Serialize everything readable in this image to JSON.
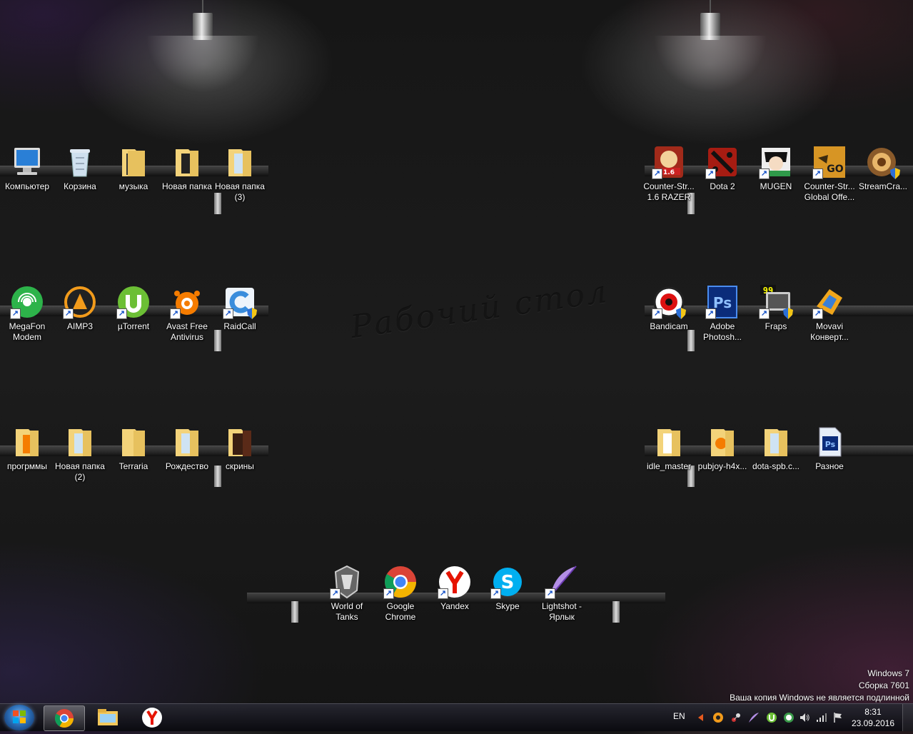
{
  "desktop": {
    "watermark": "Рабочий стол",
    "icons": [
      {
        "id": "computer",
        "label": "Компьютер"
      },
      {
        "id": "recycle",
        "label": "Корзина"
      },
      {
        "id": "music",
        "label": "музыка"
      },
      {
        "id": "newfolder",
        "label": "Новая папка"
      },
      {
        "id": "newfolder3",
        "label": "Новая папка\n(3)"
      },
      {
        "id": "megafon",
        "label": "MegaFon\nModem"
      },
      {
        "id": "aimp",
        "label": "AIMP3"
      },
      {
        "id": "utorrent",
        "label": "µTorrent"
      },
      {
        "id": "avast",
        "label": "Avast Free\nAntivirus"
      },
      {
        "id": "raidcall",
        "label": "RaidCall"
      },
      {
        "id": "programs",
        "label": "прогрммы"
      },
      {
        "id": "newfolder2",
        "label": "Новая папка\n(2)"
      },
      {
        "id": "terraria",
        "label": "Terraria"
      },
      {
        "id": "christmas",
        "label": "Рождество"
      },
      {
        "id": "screens",
        "label": "скрины"
      },
      {
        "id": "cs16",
        "label": "Counter-Str...\n1.6 RAZER"
      },
      {
        "id": "dota2",
        "label": "Dota 2"
      },
      {
        "id": "mugen",
        "label": "MUGEN"
      },
      {
        "id": "csgo",
        "label": "Counter-Str...\nGlobal Offe..."
      },
      {
        "id": "streamcraft",
        "label": "StreamCra..."
      },
      {
        "id": "bandicam",
        "label": "Bandicam"
      },
      {
        "id": "photoshop",
        "label": "Adobe\nPhotosh..."
      },
      {
        "id": "fraps",
        "label": "Fraps"
      },
      {
        "id": "movavi",
        "label": "Movavi\nКонверт..."
      },
      {
        "id": "idle",
        "label": "idle_master"
      },
      {
        "id": "pubjoy",
        "label": "pubjoy-h4x..."
      },
      {
        "id": "dotaspb",
        "label": "dota-spb.c..."
      },
      {
        "id": "misc",
        "label": "Разное"
      },
      {
        "id": "wot",
        "label": "World of\nTanks"
      },
      {
        "id": "chrome",
        "label": "Google\nChrome"
      },
      {
        "id": "yandex",
        "label": "Yandex"
      },
      {
        "id": "skype",
        "label": "Skype"
      },
      {
        "id": "lightshot",
        "label": "Lightshot -\nЯрлык"
      }
    ]
  },
  "windows_notice": {
    "line1": "Windows 7",
    "line2": "Сборка 7601",
    "line3": "Ваша копия Windows не является подлинной"
  },
  "taskbar": {
    "language": "EN",
    "time": "8:31",
    "date": "23.09.2016",
    "pinned": [
      "chrome-icon",
      "explorer-icon",
      "yandex-browser-icon"
    ]
  },
  "colors": {
    "chrome_red": "#db4437",
    "chrome_green": "#0f9d58",
    "chrome_yellow": "#f4b400",
    "chrome_blue": "#4285f4",
    "yandex_red": "#e61400",
    "folder_yellow": "#f3d37a",
    "photoshop_blue": "#0b2c7a"
  }
}
